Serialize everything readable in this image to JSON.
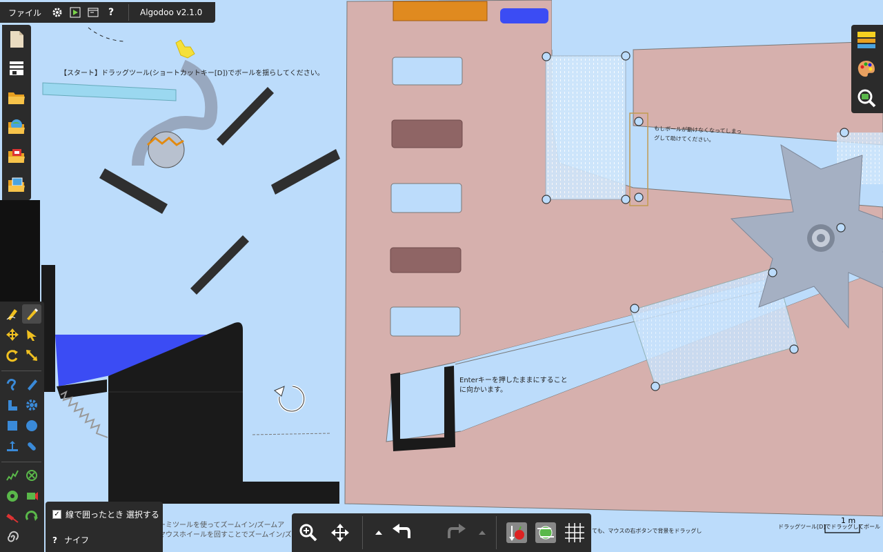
{
  "app": {
    "title": "Algodoo v2.1.0"
  },
  "menu": {
    "file_label": "ファイル",
    "help_label": "?"
  },
  "scene_text": {
    "start_hint": "【スタート】ドラッグツール(ショートカットキー[D])でボールを揺らしてください。",
    "help_line1": "もしボールが動けなくなってしまっ",
    "help_line2": "グして助けてください。",
    "enter_line1": "Enterキーを押したままにすること",
    "enter_line2": "に向かいます。",
    "zoom_line1": "ーミツールを使ってズームイン/ズームア",
    "zoom_line2": "マウスホイールを回すことでズームイン/ズー",
    "right_bottom": "ても、マウスの右ボタンで背景をドラッグし",
    "drag_hint": "ドラッグツール[D]でドラッグしてボール"
  },
  "scale_bar": {
    "label": "1 m"
  },
  "options": {
    "select_by_lasso": "線で囲ったとき 選択する",
    "select_checked": "✓",
    "knife_label": "ナイフ",
    "knife_help": "?"
  },
  "colors": {
    "sky": "#bcdcfb",
    "wall": "#d6b0ad",
    "water": "#3b4cf4",
    "panel": "#2b2b2b"
  }
}
